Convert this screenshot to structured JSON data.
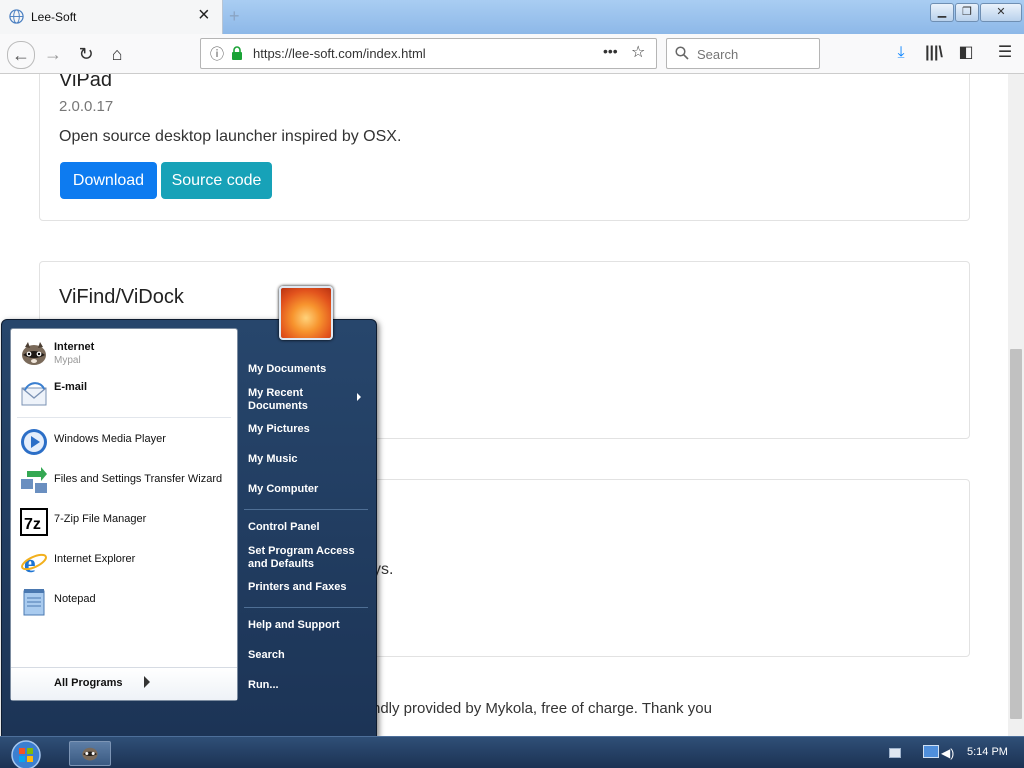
{
  "browser": {
    "tab_title": "Lee-Soft",
    "url": "https://lee-soft.com/index.html",
    "search_placeholder": "Search",
    "window_controls": [
      "minimize",
      "maximize",
      "close"
    ]
  },
  "cards": [
    {
      "title": "ViPad",
      "version": "2.0.0.17",
      "description": "Open source desktop launcher inspired by OSX.",
      "buttons": [
        "Download",
        "Source code"
      ]
    },
    {
      "title": "ViFind/ViDock"
    }
  ],
  "page_fragments": {
    "partial_text_1": "ys.",
    "footer": "ndly provided by Mykola, free of charge. Thank you"
  },
  "start_menu": {
    "pinned": [
      {
        "label": "Internet",
        "sub": "Mypal",
        "icon": "raccoon-browser-icon"
      },
      {
        "label": "E-mail",
        "icon": "mail-icon"
      }
    ],
    "recent": [
      {
        "label": "Windows Media Player",
        "icon": "media-player-icon"
      },
      {
        "label": "Files and Settings Transfer Wizard",
        "icon": "transfer-wizard-icon"
      },
      {
        "label": "7-Zip File Manager",
        "icon": "seven-zip-icon"
      },
      {
        "label": "Internet Explorer",
        "icon": "internet-explorer-icon"
      },
      {
        "label": "Notepad",
        "icon": "notepad-icon"
      }
    ],
    "all_programs": "All Programs",
    "right_items": {
      "my_documents": "My Documents",
      "my_recent_1": "My Recent",
      "my_recent_2": "Documents",
      "my_pictures": "My Pictures",
      "my_music": "My Music",
      "my_computer": "My Computer",
      "control_panel": "Control Panel",
      "set_program_1": "Set Program Access",
      "set_program_2": "and Defaults",
      "printers": "Printers and Faxes",
      "help": "Help and Support",
      "search": "Search",
      "run": "Run..."
    }
  },
  "taskbar": {
    "clock": "5:14 PM"
  },
  "colors": {
    "primary_button": "#0d7bf0",
    "info_button": "#17a2b8",
    "start_menu_bg": "#27466c"
  }
}
